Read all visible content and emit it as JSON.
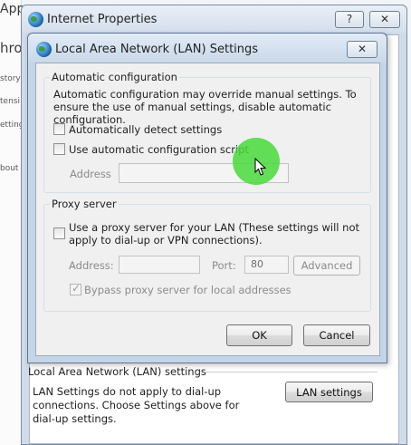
{
  "background": {
    "top_text": "Apps",
    "side_text": "hro",
    "side_items": [
      "story",
      "tensi",
      "etting",
      "bout"
    ]
  },
  "outer_window": {
    "title": "Internet Properties",
    "help_label": "?",
    "close_label": "✕",
    "lan_section": {
      "label": "Local Area Network (LAN) settings",
      "description": "LAN Settings do not apply to dial-up connections. Choose Settings above for dial-up settings.",
      "button_label": "LAN settings"
    }
  },
  "lan_dialog": {
    "title": "Local Area Network (LAN) Settings",
    "close_label": "✕",
    "auto_config": {
      "legend": "Automatic configuration",
      "description": "Automatic configuration may override manual settings.  To ensure the use of manual settings, disable automatic configuration.",
      "auto_detect": {
        "label": "Automatically detect settings",
        "checked": false
      },
      "use_script": {
        "label": "Use automatic configuration script",
        "checked": false
      },
      "address_label": "Address",
      "address_value": ""
    },
    "proxy": {
      "legend": "Proxy server",
      "use_proxy": {
        "label": "Use a proxy server for your LAN (These settings will not apply to dial-up or VPN connections).",
        "checked": false
      },
      "address_label": "Address:",
      "address_value": "",
      "port_label": "Port:",
      "port_value": "80",
      "advanced_label": "Advanced",
      "bypass": {
        "label": "Bypass proxy server for local addresses",
        "checked": true
      }
    },
    "ok_label": "OK",
    "cancel_label": "Cancel"
  },
  "colors": {
    "cursor_highlight": "#48db3a",
    "title_bar": "#c9d8e9",
    "dialog_body": "#f0f0f0"
  }
}
